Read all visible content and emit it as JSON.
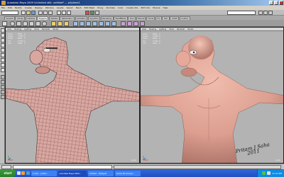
{
  "window": {
    "title": "Autodesk Maya 2009 Unlimited x64: untitled* --- pSphere1"
  },
  "menubar": {
    "items": [
      "File",
      "Edit",
      "Modify",
      "Create",
      "Display",
      "Window",
      "Assets",
      "Select",
      "Mesh",
      "Edit Mesh",
      "Proxy",
      "Normals",
      "Color",
      "Create UVs",
      "Edit UVs",
      "Muscle",
      "Help"
    ]
  },
  "shelf": {
    "tabs": [
      "General",
      "Curves",
      "Surfaces",
      "Polygons",
      "Subdivs",
      "Deformation",
      "Animation",
      "Dynamics",
      "Rendering",
      "PaintEffects",
      "Toon",
      "Muscle",
      "Fluids",
      "Fur",
      "Hair",
      "nCloth",
      "Custom"
    ],
    "active_index": 3
  },
  "viewports": {
    "left": {
      "menu": [
        "View",
        "Shading",
        "Lighting",
        "Show",
        "Renderer",
        "Panels"
      ],
      "hud": [
        {
          "k": "Verts:",
          "v": "8956",
          "s": "0"
        },
        {
          "k": "Edges:",
          "v": "17850",
          "s": "0"
        },
        {
          "k": "Faces:",
          "v": "8896",
          "s": "0"
        },
        {
          "k": "Tris:",
          "v": "17792",
          "s": "0"
        },
        {
          "k": "UVs:",
          "v": "9390",
          "s": "0"
        }
      ],
      "camera": "persp"
    },
    "right": {
      "menu": [
        "View",
        "Shading",
        "Lighting",
        "Show",
        "Renderer",
        "Panels"
      ],
      "hud": [
        {
          "k": "Verts:",
          "v": "8956",
          "s": "0"
        },
        {
          "k": "Edges:",
          "v": "17850",
          "s": "0"
        },
        {
          "k": "Faces:",
          "v": "8896",
          "s": "0"
        },
        {
          "k": "Tris:",
          "v": "17792",
          "s": "0"
        },
        {
          "k": "UVs:",
          "v": "9390",
          "s": "0"
        }
      ],
      "camera": "persp"
    }
  },
  "signature": {
    "line1": "Pritam J Saha",
    "line2": "2011"
  },
  "taskbar": {
    "start_label": "start",
    "tasks": [
      "3 Inter - pritam...",
      "Autodesk Maya 2009...",
      "Untitled - Notepad",
      "Adobe Photoshop..."
    ],
    "active_task": 1,
    "clock": "12:24 PM"
  },
  "colors": {
    "skin": "#e1a79a",
    "viewport_bg": "#b3b3b3",
    "taskbar": "#245edb",
    "start": "#3a9a3a"
  }
}
